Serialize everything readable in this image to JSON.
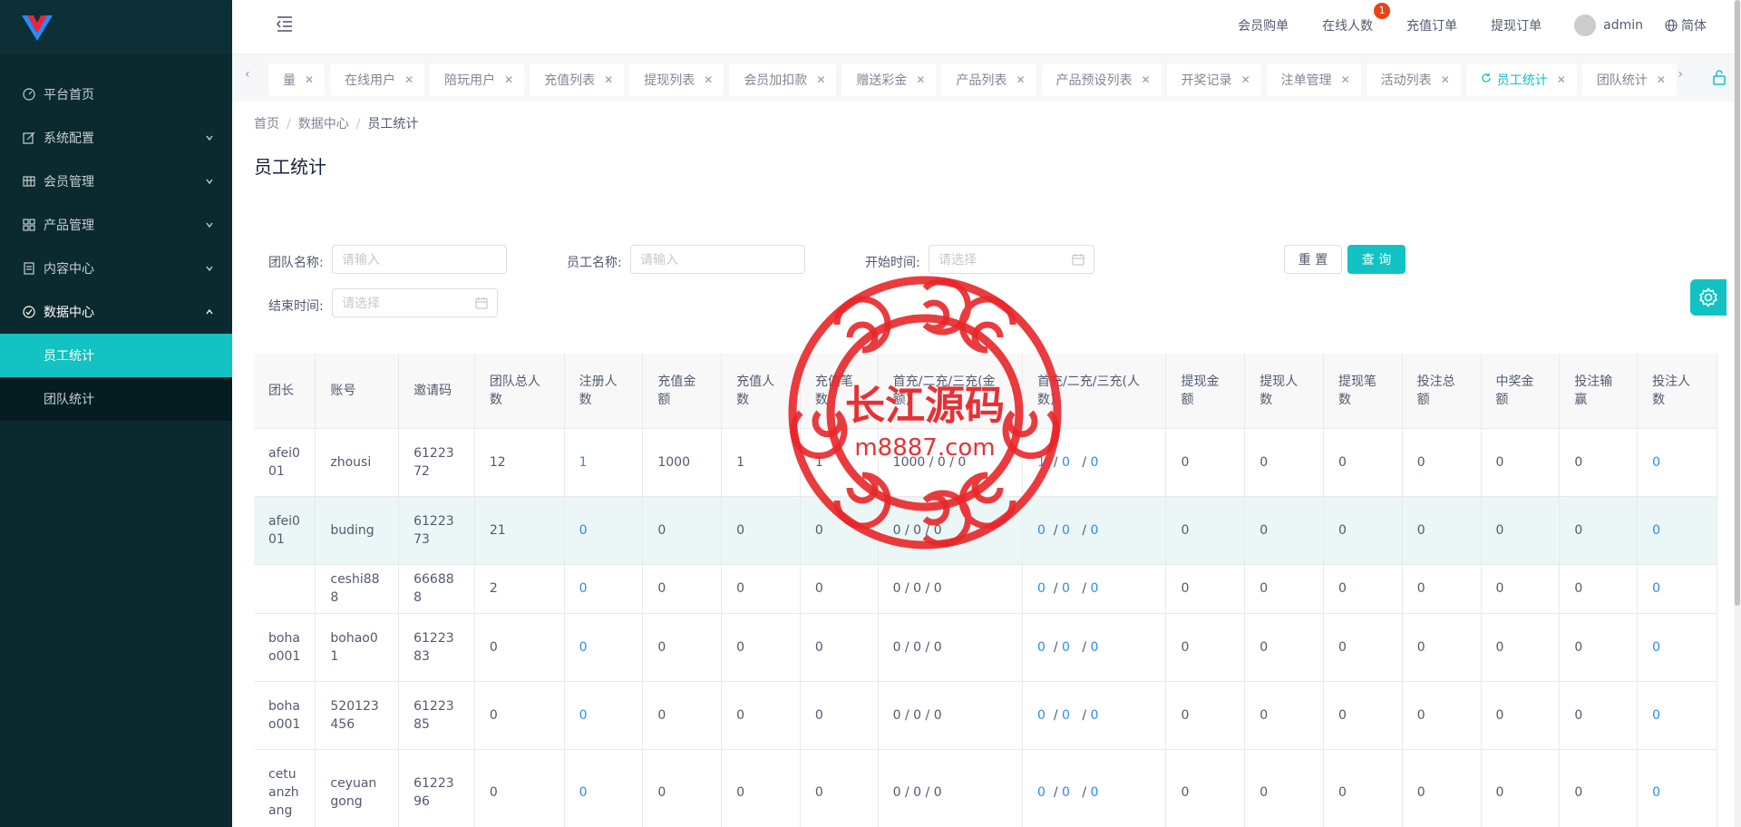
{
  "sidebar": {
    "menu": [
      {
        "label": "平台首页",
        "icon": "dashboard-icon"
      },
      {
        "label": "系统配置",
        "icon": "edit-icon"
      },
      {
        "label": "会员管理",
        "icon": "table-icon"
      },
      {
        "label": "产品管理",
        "icon": "grid-icon"
      },
      {
        "label": "内容中心",
        "icon": "document-icon"
      },
      {
        "label": "数据中心",
        "icon": "check-circle-icon"
      }
    ],
    "submenu": [
      "员工统计",
      "团队统计"
    ]
  },
  "header": {
    "links": [
      "会员购单",
      "在线人数",
      "充值订单",
      "提现订单"
    ],
    "online_badge": "1",
    "user": "admin",
    "lang": "简体"
  },
  "tabs": [
    {
      "label": "量"
    },
    {
      "label": "在线用户"
    },
    {
      "label": "陪玩用户"
    },
    {
      "label": "充值列表"
    },
    {
      "label": "提现列表"
    },
    {
      "label": "会员加扣款"
    },
    {
      "label": "赠送彩金"
    },
    {
      "label": "产品列表"
    },
    {
      "label": "产品预设列表"
    },
    {
      "label": "开奖记录"
    },
    {
      "label": "注单管理"
    },
    {
      "label": "活动列表"
    },
    {
      "label": "员工统计",
      "active": true
    },
    {
      "label": "团队统计"
    }
  ],
  "breadcrumb": [
    "首页",
    "数据中心",
    "员工统计"
  ],
  "page_title": "员工统计",
  "form": {
    "team_label": "团队名称:",
    "team_placeholder": "请输入",
    "staff_label": "员工名称:",
    "staff_placeholder": "请输入",
    "start_label": "开始时间:",
    "start_placeholder": "请选择",
    "end_label": "结束时间:",
    "end_placeholder": "请选择",
    "reset": "重 置",
    "query": "查 询"
  },
  "table": {
    "headers": [
      "团长",
      "账号",
      "邀请码",
      "团队总人数",
      "注册人数",
      "充值金额",
      "充值人数",
      "充值笔数",
      "首充/二充/三充(金额)",
      "首充/二充/三充(人数)",
      "提现金额",
      "提现人数",
      "提现笔数",
      "投注总额",
      "中奖金额",
      "投注输赢",
      "投注人数"
    ],
    "rows": [
      [
        "afei001",
        "zhousi",
        "6122372",
        "12",
        "1",
        "1000",
        "1",
        "1",
        "1000 / 0 / 0",
        [
          "1",
          "0",
          "0"
        ],
        "0",
        "0",
        "0",
        "0",
        "0",
        "0",
        "0"
      ],
      [
        "afei001",
        "buding",
        "6122373",
        "21",
        "0",
        "0",
        "0",
        "0",
        "0 / 0 / 0",
        [
          "0",
          "0",
          "0"
        ],
        "0",
        "0",
        "0",
        "0",
        "0",
        "0",
        "0"
      ],
      [
        "",
        "ceshi888",
        "666888",
        "2",
        "0",
        "0",
        "0",
        "0",
        "0 / 0 / 0",
        [
          "0",
          "0",
          "0"
        ],
        "0",
        "0",
        "0",
        "0",
        "0",
        "0",
        "0"
      ],
      [
        "bohao001",
        "bohao01",
        "6122383",
        "0",
        "0",
        "0",
        "0",
        "0",
        "0 / 0 / 0",
        [
          "0",
          "0",
          "0"
        ],
        "0",
        "0",
        "0",
        "0",
        "0",
        "0",
        "0"
      ],
      [
        "bohao001",
        "520123456",
        "6122385",
        "0",
        "0",
        "0",
        "0",
        "0",
        "0 / 0 / 0",
        [
          "0",
          "0",
          "0"
        ],
        "0",
        "0",
        "0",
        "0",
        "0",
        "0",
        "0"
      ],
      [
        "cetuanzhang",
        "ceyuangong",
        "6122396",
        "0",
        "0",
        "0",
        "0",
        "0",
        "0 / 0 / 0",
        [
          "0",
          "0",
          "0"
        ],
        "0",
        "0",
        "0",
        "0",
        "0",
        "0",
        "0"
      ]
    ]
  },
  "watermark": {
    "line1": "长江源码",
    "line2": "m8887.com",
    "color": "#e8262a"
  },
  "colors": {
    "accent": "#13c2c2",
    "sidebar": "#0a2a2f",
    "link": "#2d8cf0"
  }
}
